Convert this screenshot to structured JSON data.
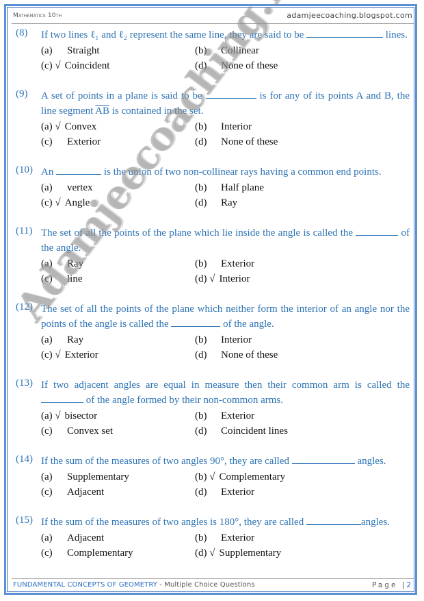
{
  "header": {
    "subject": "Mathematics 10th",
    "site": "adamjeecoaching.blogspot.com"
  },
  "questions": [
    {
      "number": "(8)",
      "text_parts": [
        "If two lines ℓ₁ and ℓ₂ represent the same line, they are said to be ",
        " lines."
      ],
      "options": [
        {
          "label": "(a)",
          "text": "Straight",
          "correct": false
        },
        {
          "label": "(b)",
          "text": "Collinear",
          "correct": false
        },
        {
          "label": "(c) √",
          "text": "Coincident",
          "correct": true
        },
        {
          "label": "(d)",
          "text": "None of these",
          "correct": false
        }
      ]
    },
    {
      "number": "(9)",
      "text_parts": [
        "A set of points in a plane is said to be ",
        " is for any of its points A and B, the line segment ",
        "AB",
        " is contained in the set."
      ],
      "options": [
        {
          "label": "(a) √",
          "text": "Convex",
          "correct": true
        },
        {
          "label": "(b)",
          "text": "Interior",
          "correct": false
        },
        {
          "label": "(c)",
          "text": "Exterior",
          "correct": false
        },
        {
          "label": "(d)",
          "text": "None of these",
          "correct": false
        }
      ]
    },
    {
      "number": "(10)",
      "text_parts": [
        "An ",
        " is the union of two non-collinear rays having a common end points."
      ],
      "options": [
        {
          "label": "(a)",
          "text": "vertex",
          "correct": false
        },
        {
          "label": "(b)",
          "text": "Half plane",
          "correct": false
        },
        {
          "label": "(c) √",
          "text": "Angle",
          "correct": true
        },
        {
          "label": "(d)",
          "text": "Ray",
          "correct": false
        }
      ]
    },
    {
      "number": "(11)",
      "text_parts": [
        "The set of all the points of the plane which lie inside the angle is called the ",
        " of the angle."
      ],
      "options": [
        {
          "label": "(a)",
          "text": "Ray",
          "correct": false
        },
        {
          "label": "(b)",
          "text": "Exterior",
          "correct": false
        },
        {
          "label": "(c)",
          "text": "line",
          "correct": false
        },
        {
          "label": "(d) √",
          "text": "Interior",
          "correct": true
        }
      ]
    },
    {
      "number": "(12)",
      "text_parts": [
        "The set of all the points of the plane which neither form the interior of an angle nor the points of the angle is called the ",
        " of the angle."
      ],
      "options": [
        {
          "label": "(a)",
          "text": "Ray",
          "correct": false
        },
        {
          "label": "(b)",
          "text": "Interior",
          "correct": false
        },
        {
          "label": "(c) √",
          "text": "Exterior",
          "correct": true
        },
        {
          "label": "(d)",
          "text": "None of these",
          "correct": false
        }
      ]
    },
    {
      "number": "(13)",
      "text_parts": [
        "If two adjacent angles are equal in measure then their common arm is called the ",
        " of the angle formed by their non-common arms."
      ],
      "options": [
        {
          "label": "(a) √",
          "text": "bisector",
          "correct": true
        },
        {
          "label": "(b)",
          "text": "Exterior",
          "correct": false
        },
        {
          "label": "(c)",
          "text": "Convex set",
          "correct": false
        },
        {
          "label": "(d)",
          "text": "Coincident lines",
          "correct": false
        }
      ]
    },
    {
      "number": "(14)",
      "text_parts": [
        "If the sum of the measures of two angles 90°, they are called ",
        " angles."
      ],
      "options": [
        {
          "label": "(a)",
          "text": "Supplementary",
          "correct": false
        },
        {
          "label": "(b) √",
          "text": "Complementary",
          "correct": true
        },
        {
          "label": "(c)",
          "text": "Adjacent",
          "correct": false
        },
        {
          "label": "(d)",
          "text": "Exterior",
          "correct": false
        }
      ]
    },
    {
      "number": "(15)",
      "text_parts": [
        "If the sum of the measures of two angles is 180°, they are called ",
        "angles."
      ],
      "options": [
        {
          "label": "(a)",
          "text": "Adjacent",
          "correct": false
        },
        {
          "label": "(b)",
          "text": "Exterior",
          "correct": false
        },
        {
          "label": "(c)",
          "text": "Complementary",
          "correct": false
        },
        {
          "label": "(d) √",
          "text": "Supplementary",
          "correct": true
        }
      ]
    }
  ],
  "watermark": "Adamjeecoaching.Blogspot.com",
  "footer": {
    "chapter": "FUNDAMENTAL CONCEPTS OF GEOMETRY",
    "section": " - Multiple Choice Questions",
    "page_label": "Page",
    "page_sep": "|",
    "page_number": "2"
  },
  "colors": {
    "question_text": "#2e74b5",
    "frame": "#5b8fd6",
    "footer_accent": "#2d6fc2"
  }
}
